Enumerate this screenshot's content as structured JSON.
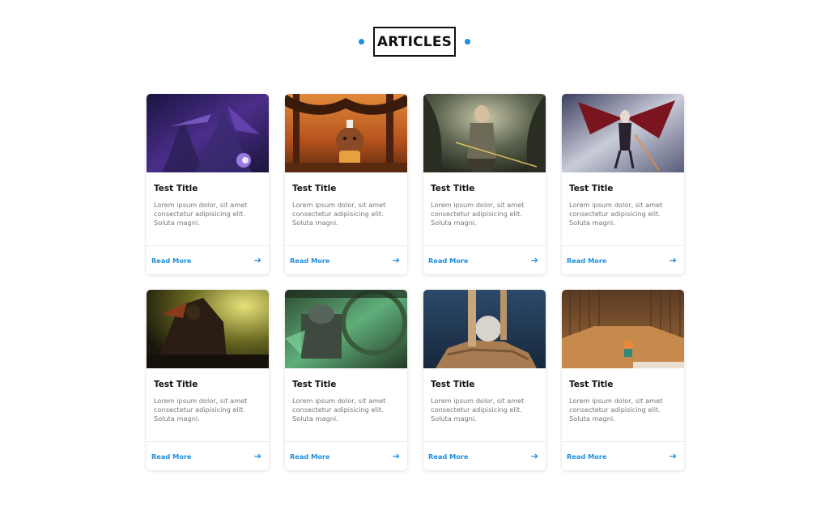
{
  "header": {
    "title": "ARTICLES",
    "accent_color": "#1e8fe0"
  },
  "cards": [
    {
      "title": "Test Title",
      "text": "Lorem ipsum dolor, sit amet consectetur adipisicing elit. Soluta magni.",
      "link": "Read More",
      "image": "purple-fantasy-battle-scene"
    },
    {
      "title": "Test Title",
      "text": "Lorem ipsum dolor, sit amet consectetur adipisicing elit. Soluta magni.",
      "link": "Read More",
      "image": "orange-forest-cartoon-character"
    },
    {
      "title": "Test Title",
      "text": "Lorem ipsum dolor, sit amet consectetur adipisicing elit. Soluta magni.",
      "link": "Read More",
      "image": "archer-in-forest"
    },
    {
      "title": "Test Title",
      "text": "Lorem ipsum dolor, sit amet consectetur adipisicing elit. Soluta magni.",
      "link": "Read More",
      "image": "winged-dark-warrior"
    },
    {
      "title": "Test Title",
      "text": "Lorem ipsum dolor, sit amet consectetur adipisicing elit. Soluta magni.",
      "link": "Read More",
      "image": "armored-knight-yellow-sky"
    },
    {
      "title": "Test Title",
      "text": "Lorem ipsum dolor, sit amet consectetur adipisicing elit. Soluta magni.",
      "link": "Read More",
      "image": "green-mechanical-temple"
    },
    {
      "title": "Test Title",
      "text": "Lorem ipsum dolor, sit amet consectetur adipisicing elit. Soluta magni.",
      "link": "Read More",
      "image": "stone-ball-on-rock"
    },
    {
      "title": "Test Title",
      "text": "Lorem ipsum dolor, sit amet consectetur adipisicing elit. Soluta magni.",
      "link": "Read More",
      "image": "wooden-room-character"
    }
  ]
}
